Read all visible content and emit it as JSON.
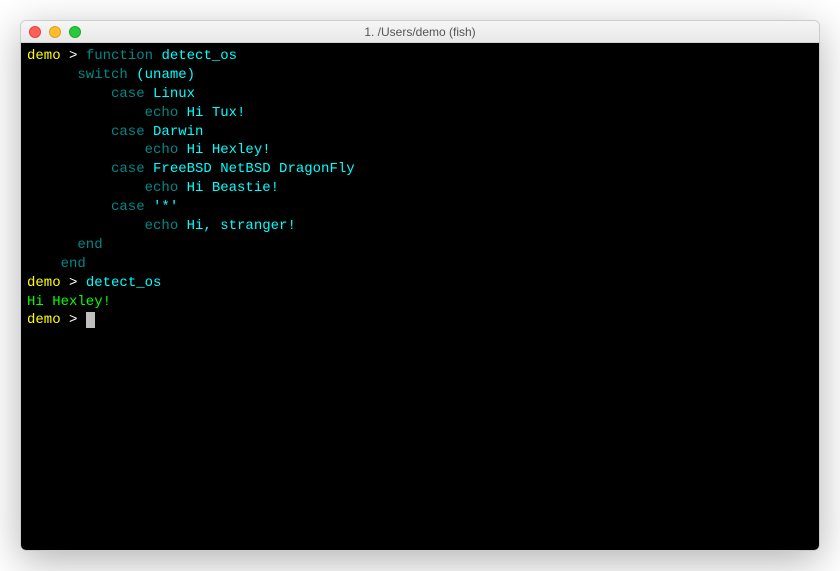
{
  "window": {
    "title": "1. /Users/demo (fish)"
  },
  "prompt": {
    "user": "demo",
    "sep": " > "
  },
  "code": {
    "kw_function": "function",
    "fn_name": "detect_os",
    "kw_switch": "switch",
    "switch_arg_open": " (",
    "switch_arg": "uname",
    "switch_arg_close": ")",
    "kw_case": "case",
    "case1": "Linux",
    "case2": "Darwin",
    "case3": "FreeBSD NetBSD DragonFly",
    "case4": "'*'",
    "kw_echo": "echo",
    "echo1": "Hi Tux!",
    "echo2": "Hi Hexley!",
    "echo3": "Hi Beastie!",
    "echo4": "Hi, stranger!",
    "kw_end": "end"
  },
  "call": {
    "cmd": "detect_os"
  },
  "output": {
    "line1": "Hi Hexley!"
  }
}
